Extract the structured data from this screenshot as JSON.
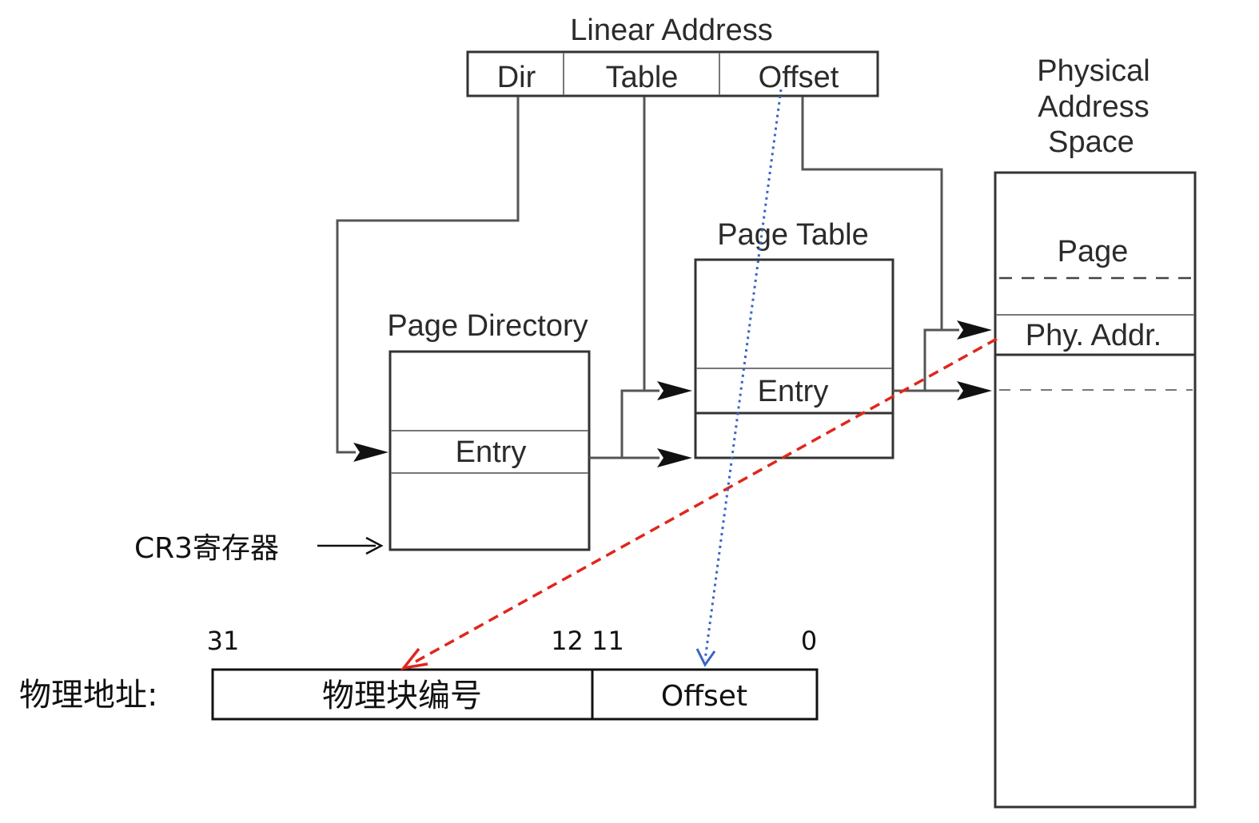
{
  "linear_address": {
    "title": "Linear Address",
    "fields": [
      "Dir",
      "Table",
      "Offset"
    ]
  },
  "page_directory": {
    "title": "Page Directory",
    "entry": "Entry"
  },
  "page_table": {
    "title": "Page Table",
    "entry": "Entry"
  },
  "physical_space": {
    "title_lines": [
      "Physical",
      "Address",
      "Space"
    ],
    "page": "Page",
    "phy_addr": "Phy. Addr."
  },
  "cr3": {
    "label": "CR3寄存器"
  },
  "physical_address": {
    "label": "物理地址:",
    "block_field": "物理块编号",
    "offset_field": "Offset",
    "bits": {
      "b31": "31",
      "b12_11": "12 11",
      "b0": "0"
    }
  },
  "colors": {
    "red_arrow": "#e0261c",
    "blue_arrow": "#3a64c4",
    "box_stroke": "#333333"
  }
}
